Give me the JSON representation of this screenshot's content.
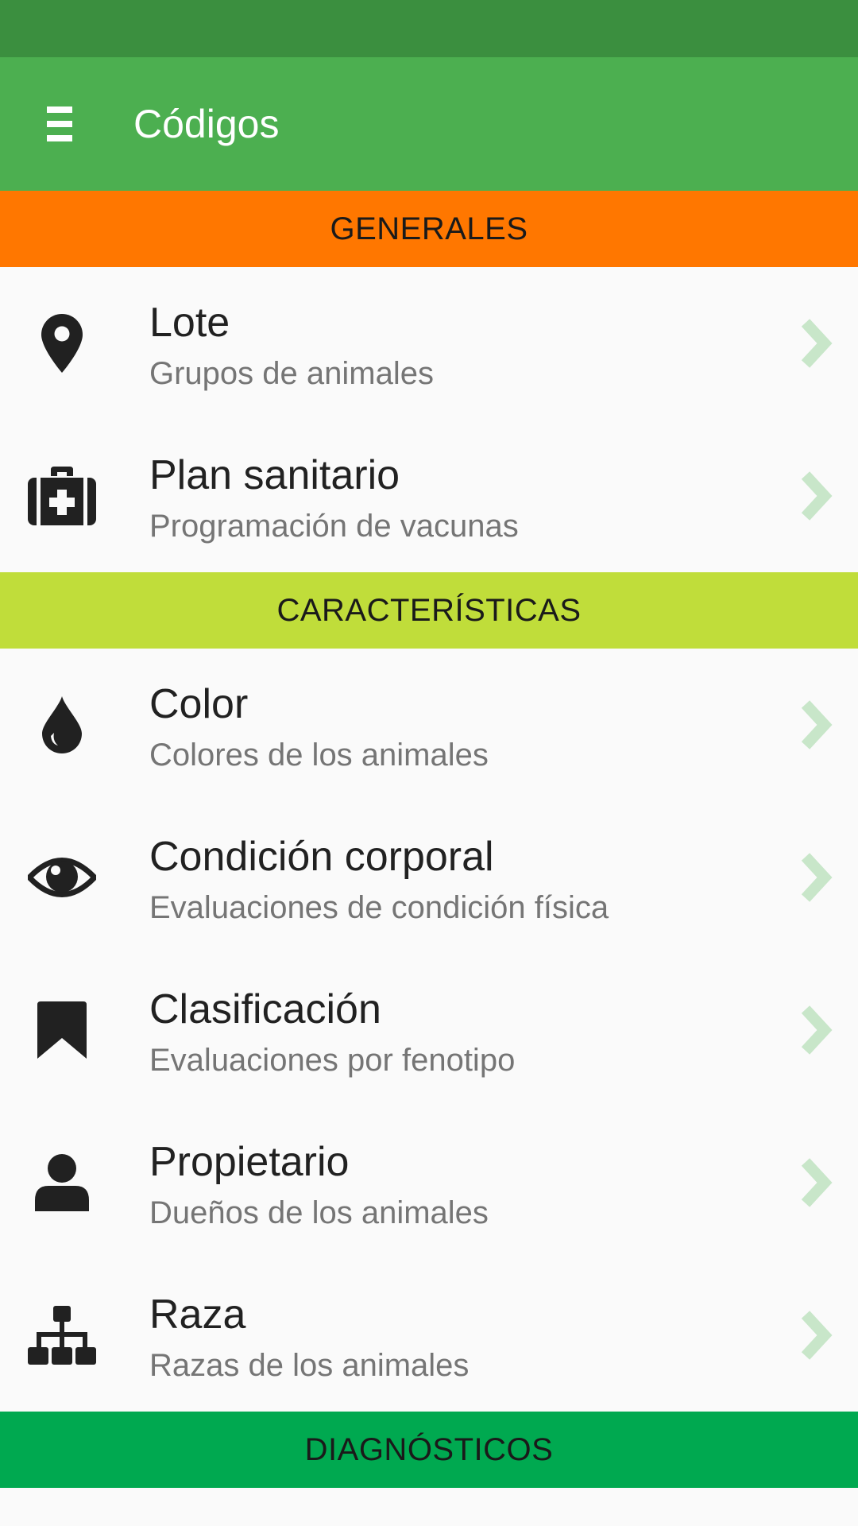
{
  "app_bar": {
    "title": "Códigos",
    "menu_icon": "menu-icon"
  },
  "colors": {
    "status_bar": "#3b8f3f",
    "app_bar": "#4caf50",
    "generales": "#ff7700",
    "caracteristicas": "#c0dd3a",
    "diagnosticos": "#00a950",
    "chevron": "#c8e6c9"
  },
  "sections": [
    {
      "header": "GENERALES",
      "items": [
        {
          "title": "Lote",
          "subtitle": "Grupos de animales",
          "icon": "map-pin-icon"
        },
        {
          "title": "Plan sanitario",
          "subtitle": "Programación de vacunas",
          "icon": "medkit-icon"
        }
      ]
    },
    {
      "header": "CARACTERÍSTICAS",
      "items": [
        {
          "title": "Color",
          "subtitle": "Colores de los animales",
          "icon": "drop-icon"
        },
        {
          "title": "Condición corporal",
          "subtitle": "Evaluaciones de condición física",
          "icon": "eye-icon"
        },
        {
          "title": "Clasificación",
          "subtitle": "Evaluaciones por fenotipo",
          "icon": "bookmark-icon"
        },
        {
          "title": "Propietario",
          "subtitle": "Dueños de los animales",
          "icon": "user-icon"
        },
        {
          "title": "Raza",
          "subtitle": "Razas de los animales",
          "icon": "sitemap-icon"
        }
      ]
    },
    {
      "header": "DIAGNÓSTICOS",
      "items": []
    }
  ]
}
